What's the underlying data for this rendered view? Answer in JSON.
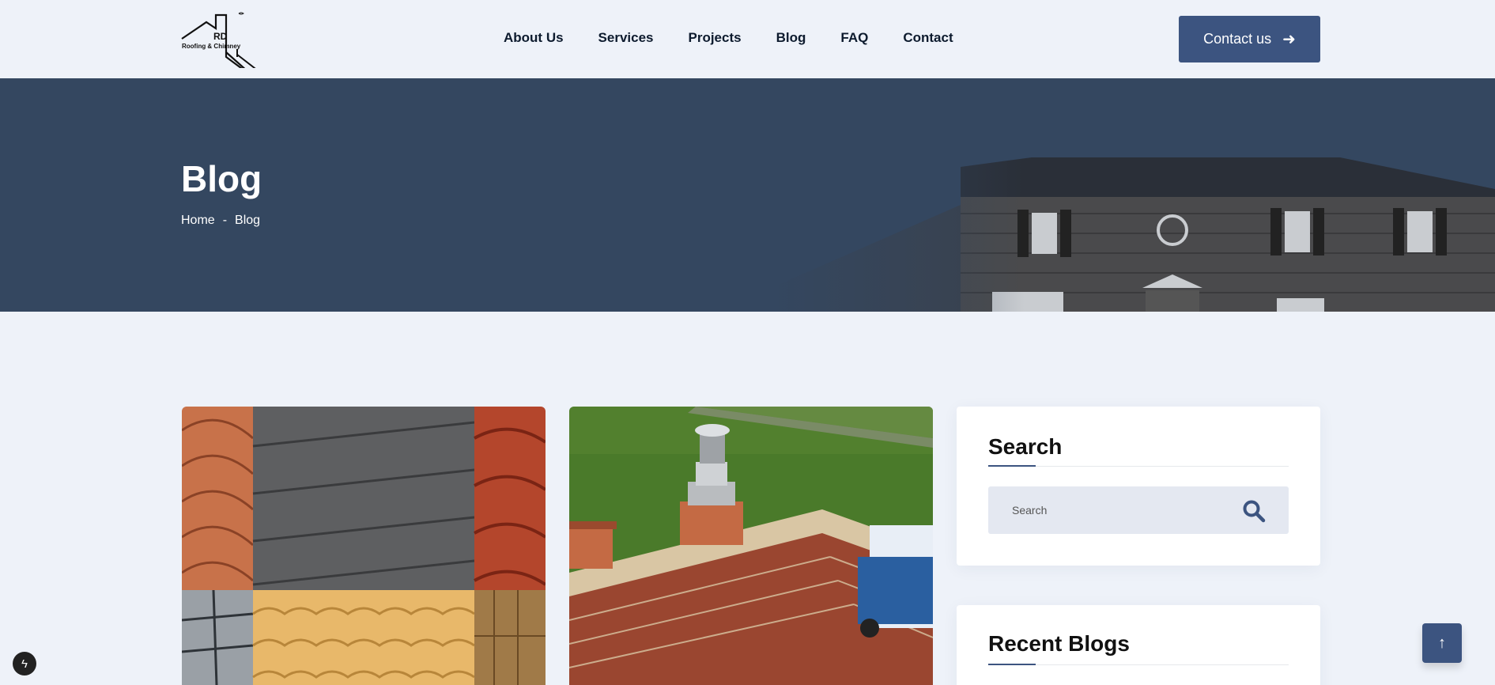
{
  "header": {
    "logo": {
      "name": "RD",
      "subtitle": "Roofing & Chimney"
    },
    "nav": [
      "About Us",
      "Services",
      "Projects",
      "Blog",
      "FAQ",
      "Contact"
    ],
    "cta_label": "Contact us",
    "cta_icon": "arrow-right-icon"
  },
  "hero": {
    "title": "Blog",
    "breadcrumb": {
      "home": "Home",
      "separator": "-",
      "current": "Blog"
    }
  },
  "sidebar": {
    "search": {
      "title": "Search",
      "placeholder": "Search",
      "icon": "search-icon"
    },
    "recent": {
      "title": "Recent Blogs"
    }
  },
  "colors": {
    "accent": "#3c5480",
    "hero_bg": "#344760",
    "page_bg": "#eef2f9"
  }
}
